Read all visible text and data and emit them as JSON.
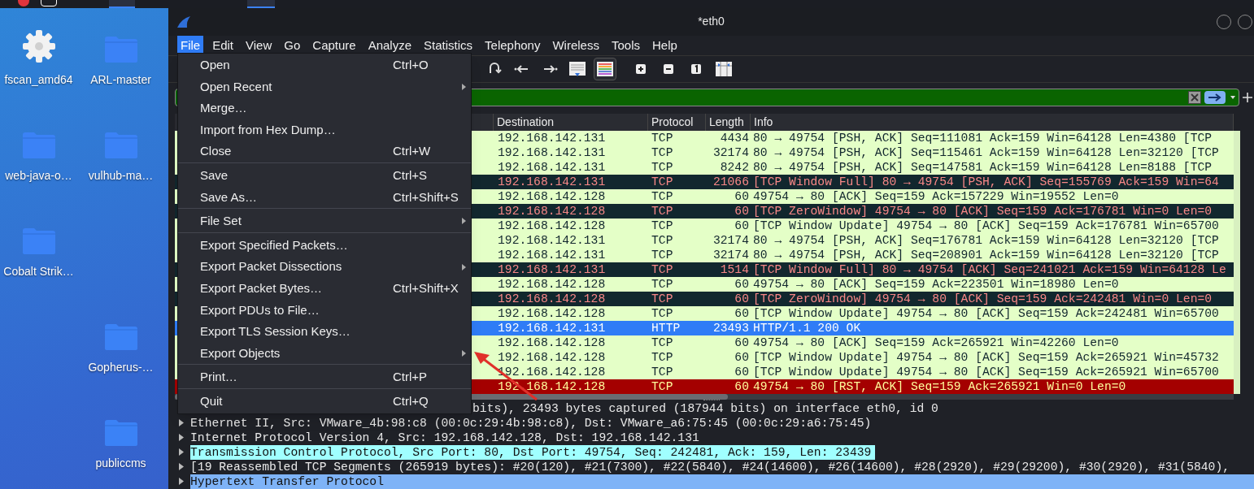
{
  "desktop": {
    "rows": [
      {
        "left": {
          "label": "fscan_amd64",
          "kind": "settings"
        },
        "right": {
          "label": "ARL-master",
          "kind": "folder"
        }
      },
      {
        "left": {
          "label": "web-java-o…",
          "kind": "folder"
        },
        "right": {
          "label": "vulhub-ma…",
          "kind": "folder"
        }
      },
      {
        "left": {
          "label": "Cobalt Strik…",
          "kind": "folder"
        }
      },
      {
        "right": {
          "label": "Gopherus-…",
          "kind": "folder"
        }
      },
      {
        "right": {
          "label": "publiccms",
          "kind": "folder"
        }
      }
    ]
  },
  "window": {
    "title": "*eth0"
  },
  "menubar": [
    {
      "label": "File",
      "selected": true
    },
    {
      "label": "Edit",
      "selected": false
    },
    {
      "label": "View",
      "selected": false
    },
    {
      "label": "Go",
      "selected": false
    },
    {
      "label": "Capture",
      "selected": false
    },
    {
      "label": "Analyze",
      "selected": false
    },
    {
      "label": "Statistics",
      "selected": false
    },
    {
      "label": "Telephony",
      "selected": false
    },
    {
      "label": "Wireless",
      "selected": false
    },
    {
      "label": "Tools",
      "selected": false
    },
    {
      "label": "Help",
      "selected": false
    }
  ],
  "file_menu": [
    {
      "label": "Open",
      "shortcut": "Ctrl+O",
      "separator_before": false,
      "submenu": false
    },
    {
      "label": "Open Recent",
      "separator_before": false,
      "submenu": true
    },
    {
      "label": "Merge…",
      "separator_before": false,
      "submenu": false
    },
    {
      "label": "Import from Hex Dump…",
      "separator_before": false,
      "submenu": false
    },
    {
      "label": "Close",
      "shortcut": "Ctrl+W",
      "separator_before": false,
      "submenu": false
    },
    {
      "label": "Save",
      "shortcut": "Ctrl+S",
      "separator_before": true,
      "submenu": false
    },
    {
      "label": "Save As…",
      "shortcut": "Ctrl+Shift+S",
      "separator_before": false,
      "submenu": false
    },
    {
      "label": "File Set",
      "separator_before": true,
      "submenu": true
    },
    {
      "label": "Export Specified Packets…",
      "separator_before": true,
      "submenu": false
    },
    {
      "label": "Export Packet Dissections",
      "separator_before": false,
      "submenu": true
    },
    {
      "label": "Export Packet Bytes…",
      "shortcut": "Ctrl+Shift+X",
      "separator_before": false,
      "submenu": false
    },
    {
      "label": "Export PDUs to File…",
      "separator_before": false,
      "submenu": false
    },
    {
      "label": "Export TLS Session Keys…",
      "separator_before": false,
      "submenu": false
    },
    {
      "label": "Export Objects",
      "separator_before": false,
      "submenu": true
    },
    {
      "label": "Print…",
      "shortcut": "Ctrl+P",
      "separator_before": true,
      "submenu": false
    },
    {
      "label": "Quit",
      "shortcut": "Ctrl+Q",
      "separator_before": true,
      "submenu": false
    }
  ],
  "packet_list": {
    "columns": [
      "Destination",
      "Protocol",
      "Length",
      "Info"
    ],
    "rows": [
      {
        "destination": "192.168.142.131",
        "protocol": "TCP",
        "length": "4434",
        "info": "80 → 49754 [PSH, ACK] Seq=111081 Ack=159 Win=64128 Len=4380 [TCP",
        "kind": "ok",
        "selected": false
      },
      {
        "destination": "192.168.142.131",
        "protocol": "TCP",
        "length": "32174",
        "info": "80 → 49754 [PSH, ACK] Seq=115461 Ack=159 Win=64128 Len=32120 [TCP",
        "kind": "ok",
        "selected": false
      },
      {
        "destination": "192.168.142.131",
        "protocol": "TCP",
        "length": "8242",
        "info": "80 → 49754 [PSH, ACK] Seq=147581 Ack=159 Win=64128 Len=8188 [TCP",
        "kind": "ok",
        "selected": false
      },
      {
        "destination": "192.168.142.131",
        "protocol": "TCP",
        "length": "21066",
        "info": "[TCP Window Full] 80 → 49754 [PSH, ACK] Seq=155769 Ack=159 Win=64",
        "kind": "warning",
        "selected": false
      },
      {
        "destination": "192.168.142.128",
        "protocol": "TCP",
        "length": "60",
        "info": "49754 → 80 [ACK] Seq=159 Ack=157229 Win=19552 Len=0",
        "kind": "ok",
        "selected": false
      },
      {
        "destination": "192.168.142.128",
        "protocol": "TCP",
        "length": "60",
        "info": "[TCP ZeroWindow] 49754 → 80 [ACK] Seq=159 Ack=176781 Win=0 Len=0",
        "kind": "warning",
        "selected": false
      },
      {
        "destination": "192.168.142.128",
        "protocol": "TCP",
        "length": "60",
        "info": "[TCP Window Update] 49754 → 80 [ACK] Seq=159 Ack=176781 Win=65700",
        "kind": "ok",
        "selected": false
      },
      {
        "destination": "192.168.142.131",
        "protocol": "TCP",
        "length": "32174",
        "info": "80 → 49754 [PSH, ACK] Seq=176781 Ack=159 Win=64128 Len=32120 [TCP",
        "kind": "ok",
        "selected": false
      },
      {
        "destination": "192.168.142.131",
        "protocol": "TCP",
        "length": "32174",
        "info": "80 → 49754 [PSH, ACK] Seq=208901 Ack=159 Win=64128 Len=32120 [TCP",
        "kind": "ok",
        "selected": false
      },
      {
        "destination": "192.168.142.131",
        "protocol": "TCP",
        "length": "1514",
        "info": "[TCP Window Full] 80 → 49754 [ACK] Seq=241021 Ack=159 Win=64128 Le",
        "kind": "warning",
        "selected": false
      },
      {
        "destination": "192.168.142.128",
        "protocol": "TCP",
        "length": "60",
        "info": "49754 → 80 [ACK] Seq=159 Ack=223501 Win=18980 Len=0",
        "kind": "ok",
        "selected": false
      },
      {
        "destination": "192.168.142.128",
        "protocol": "TCP",
        "length": "60",
        "info": "[TCP ZeroWindow] 49754 → 80 [ACK] Seq=159 Ack=242481 Win=0 Len=0",
        "kind": "warning",
        "selected": false
      },
      {
        "destination": "192.168.142.128",
        "protocol": "TCP",
        "length": "60",
        "info": "[TCP Window Update] 49754 → 80 [ACK] Seq=159 Ack=242481 Win=65700",
        "kind": "ok",
        "selected": false
      },
      {
        "destination": "192.168.142.131",
        "protocol": "HTTP",
        "length": "23493",
        "info": "HTTP/1.1 200 OK",
        "kind": "ok",
        "selected": true
      },
      {
        "destination": "192.168.142.128",
        "protocol": "TCP",
        "length": "60",
        "info": "49754 → 80 [ACK] Seq=159 Ack=265921 Win=42260 Len=0",
        "kind": "ok",
        "selected": false
      },
      {
        "destination": "192.168.142.128",
        "protocol": "TCP",
        "length": "60",
        "info": "[TCP Window Update] 49754 → 80 [ACK] Seq=159 Ack=265921 Win=45732",
        "kind": "ok",
        "selected": false
      },
      {
        "destination": "192.168.142.128",
        "protocol": "TCP",
        "length": "60",
        "info": "[TCP Window Update] 49754 → 80 [ACK] Seq=159 Ack=265921 Win=65700",
        "kind": "ok",
        "selected": false
      },
      {
        "destination": "192.168.142.128",
        "protocol": "TCP",
        "length": "60",
        "info": "49754 → 80 [RST, ACK] Seq=159 Ack=265921 Win=0 Len=0",
        "kind": "error",
        "selected": false
      }
    ]
  },
  "details": [
    {
      "text": "bits), 23493 bytes captured (187944 bits) on interface eth0, id 0",
      "partial": true,
      "highlighted": false,
      "selected": false
    },
    {
      "text": "Ethernet II, Src: VMware_4b:98:c8 (00:0c:29:4b:98:c8), Dst: VMware_a6:75:45 (00:0c:29:a6:75:45)",
      "highlighted": false,
      "selected": false
    },
    {
      "text": "Internet Protocol Version 4, Src: 192.168.142.128, Dst: 192.168.142.131",
      "highlighted": false,
      "selected": false
    },
    {
      "text": "Transmission Control Protocol, Src Port: 80, Dst Port: 49754, Seq: 242481, Ack: 159, Len: 23439",
      "highlighted": true,
      "selected": false
    },
    {
      "text": "[19 Reassembled TCP Segments (265919 bytes): #20(120), #21(7300), #22(5840), #24(14600), #26(14600), #28(2920), #29(29200), #30(2920), #31(5840),",
      "highlighted": false,
      "selected": false
    },
    {
      "text": "Hypertext Transfer Protocol",
      "highlighted": false,
      "selected": true
    }
  ]
}
